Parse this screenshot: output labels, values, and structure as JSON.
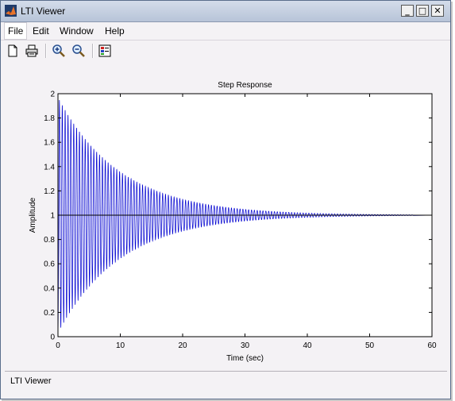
{
  "window": {
    "title": "LTI Viewer",
    "controls": {
      "minimize": "_",
      "maximize": "□",
      "close": "✕"
    }
  },
  "menu": {
    "items": [
      "File",
      "Edit",
      "Window",
      "Help"
    ],
    "active": "File"
  },
  "toolbar": {
    "tools": [
      "new-document-icon",
      "print-icon",
      "zoom-in-icon",
      "zoom-out-icon",
      "plot-configuration-icon"
    ]
  },
  "status": {
    "text": "LTI Viewer"
  },
  "colors": {
    "series": "#0000d0",
    "reference": "#000000"
  },
  "chart_data": {
    "type": "line",
    "title": "Step Response",
    "xlabel": "Time (sec)",
    "ylabel": "Amplitude",
    "xlim": [
      0,
      60
    ],
    "ylim": [
      0,
      2
    ],
    "xticks": [
      "0",
      "10",
      "20",
      "30",
      "40",
      "50",
      "60"
    ],
    "yticks": [
      "0",
      "0.2",
      "0.4",
      "0.6",
      "0.8",
      "1",
      "1.2",
      "1.4",
      "1.6",
      "1.8",
      "2"
    ],
    "grid": false,
    "reference_line": {
      "y": 1
    },
    "series": [
      {
        "description": "underdamped oscillatory step response",
        "steady_state": 1,
        "initial_peak": 1.97,
        "decay_time_constant": 10,
        "oscillation_period": 0.46,
        "end_time": 57
      }
    ]
  }
}
